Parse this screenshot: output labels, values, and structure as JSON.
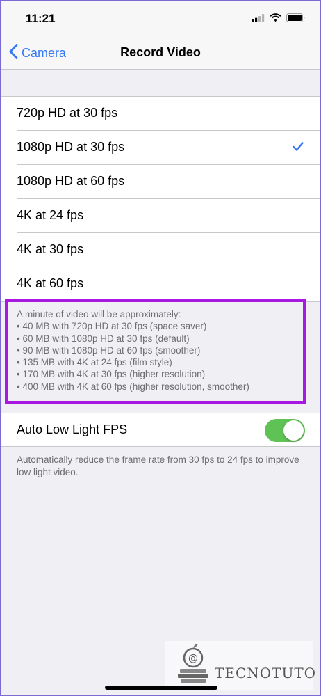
{
  "status_bar": {
    "time": "11:21",
    "icons": [
      "signal-icon",
      "wifi-icon",
      "battery-icon"
    ]
  },
  "nav": {
    "back_label": "Camera",
    "title": "Record Video"
  },
  "options": [
    {
      "label": "720p HD at 30 fps",
      "selected": false
    },
    {
      "label": "1080p HD at 30 fps",
      "selected": true
    },
    {
      "label": "1080p HD at 60 fps",
      "selected": false
    },
    {
      "label": "4K at 24 fps",
      "selected": false
    },
    {
      "label": "4K at 30 fps",
      "selected": false
    },
    {
      "label": "4K at 60 fps",
      "selected": false
    }
  ],
  "size_info": {
    "heading": "A minute of video will be approximately:",
    "lines": [
      "• 40 MB with 720p HD at 30 fps (space saver)",
      "• 60 MB with 1080p HD at 30 fps (default)",
      "• 90 MB with 1080p HD at 60 fps (smoother)",
      "• 135 MB with 4K at 24 fps (film style)",
      "• 170 MB with 4K at 30 fps (higher resolution)",
      "• 400 MB with 4K at 60 fps (higher resolution, smoother)"
    ]
  },
  "low_light": {
    "label": "Auto Low Light FPS",
    "enabled": true,
    "footer": "Automatically reduce the frame rate from 30 fps to 24 fps to improve low light video."
  },
  "watermark": {
    "text": "TECNOTUTO"
  },
  "colors": {
    "accent": "#3478f6",
    "toggle_on": "#5fc254",
    "highlight_box": "#a818e0",
    "background": "#efeff4"
  }
}
